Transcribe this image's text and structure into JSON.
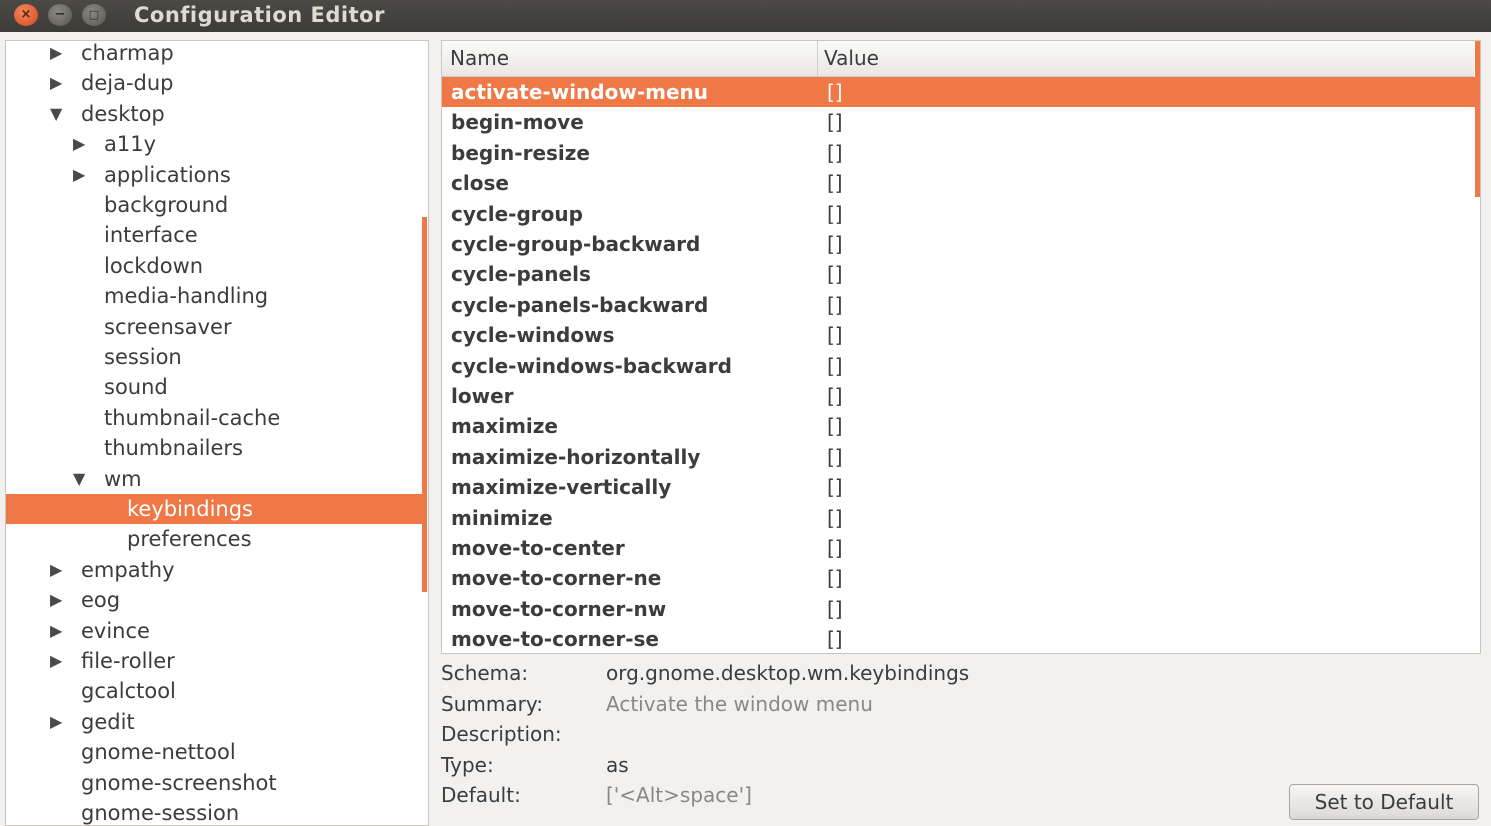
{
  "window": {
    "title": "Configuration Editor",
    "close_glyph": "×",
    "minimize_glyph": "−",
    "maximize_glyph": "□"
  },
  "tree": {
    "rows": [
      {
        "label": "charmap",
        "expander": "▶",
        "depth": 0,
        "selected": false
      },
      {
        "label": "deja-dup",
        "expander": "▶",
        "depth": 0,
        "selected": false
      },
      {
        "label": "desktop",
        "expander": "▼",
        "depth": 0,
        "selected": false
      },
      {
        "label": "a11y",
        "expander": "▶",
        "depth": 1,
        "selected": false
      },
      {
        "label": "applications",
        "expander": "▶",
        "depth": 1,
        "selected": false
      },
      {
        "label": "background",
        "expander": "",
        "depth": 1,
        "selected": false
      },
      {
        "label": "interface",
        "expander": "",
        "depth": 1,
        "selected": false
      },
      {
        "label": "lockdown",
        "expander": "",
        "depth": 1,
        "selected": false
      },
      {
        "label": "media-handling",
        "expander": "",
        "depth": 1,
        "selected": false
      },
      {
        "label": "screensaver",
        "expander": "",
        "depth": 1,
        "selected": false
      },
      {
        "label": "session",
        "expander": "",
        "depth": 1,
        "selected": false
      },
      {
        "label": "sound",
        "expander": "",
        "depth": 1,
        "selected": false
      },
      {
        "label": "thumbnail-cache",
        "expander": "",
        "depth": 1,
        "selected": false
      },
      {
        "label": "thumbnailers",
        "expander": "",
        "depth": 1,
        "selected": false
      },
      {
        "label": "wm",
        "expander": "▼",
        "depth": 1,
        "selected": false
      },
      {
        "label": "keybindings",
        "expander": "",
        "depth": 2,
        "selected": true
      },
      {
        "label": "preferences",
        "expander": "",
        "depth": 2,
        "selected": false
      },
      {
        "label": "empathy",
        "expander": "▶",
        "depth": 0,
        "selected": false
      },
      {
        "label": "eog",
        "expander": "▶",
        "depth": 0,
        "selected": false
      },
      {
        "label": "evince",
        "expander": "▶",
        "depth": 0,
        "selected": false
      },
      {
        "label": "file-roller",
        "expander": "▶",
        "depth": 0,
        "selected": false
      },
      {
        "label": "gcalctool",
        "expander": "",
        "depth": 0,
        "selected": false
      },
      {
        "label": "gedit",
        "expander": "▶",
        "depth": 0,
        "selected": false
      },
      {
        "label": "gnome-nettool",
        "expander": "",
        "depth": 0,
        "selected": false
      },
      {
        "label": "gnome-screenshot",
        "expander": "",
        "depth": 0,
        "selected": false
      },
      {
        "label": "gnome-session",
        "expander": "",
        "depth": 0,
        "selected": false
      }
    ]
  },
  "list": {
    "columns": {
      "name": "Name",
      "value": "Value"
    },
    "rows": [
      {
        "name": "activate-window-menu",
        "value": "[]",
        "selected": true
      },
      {
        "name": "begin-move",
        "value": "[]",
        "selected": false
      },
      {
        "name": "begin-resize",
        "value": "[]",
        "selected": false
      },
      {
        "name": "close",
        "value": "[]",
        "selected": false
      },
      {
        "name": "cycle-group",
        "value": "[]",
        "selected": false
      },
      {
        "name": "cycle-group-backward",
        "value": "[]",
        "selected": false
      },
      {
        "name": "cycle-panels",
        "value": "[]",
        "selected": false
      },
      {
        "name": "cycle-panels-backward",
        "value": "[]",
        "selected": false
      },
      {
        "name": "cycle-windows",
        "value": "[]",
        "selected": false
      },
      {
        "name": "cycle-windows-backward",
        "value": "[]",
        "selected": false
      },
      {
        "name": "lower",
        "value": "[]",
        "selected": false
      },
      {
        "name": "maximize",
        "value": "[]",
        "selected": false
      },
      {
        "name": "maximize-horizontally",
        "value": "[]",
        "selected": false
      },
      {
        "name": "maximize-vertically",
        "value": "[]",
        "selected": false
      },
      {
        "name": "minimize",
        "value": "[]",
        "selected": false
      },
      {
        "name": "move-to-center",
        "value": "[]",
        "selected": false
      },
      {
        "name": "move-to-corner-ne",
        "value": "[]",
        "selected": false
      },
      {
        "name": "move-to-corner-nw",
        "value": "[]",
        "selected": false
      },
      {
        "name": "move-to-corner-se",
        "value": "[]",
        "selected": false
      }
    ]
  },
  "details": {
    "schema_label": "Schema:",
    "schema_value": "org.gnome.desktop.wm.keybindings",
    "summary_label": "Summary:",
    "summary_value": "Activate the window menu",
    "description_label": "Description:",
    "description_value": "",
    "type_label": "Type:",
    "type_value": "as",
    "default_label": "Default:",
    "default_value": "['<Alt>space']"
  },
  "buttons": {
    "set_to_default": "Set to Default"
  },
  "colors": {
    "accent": "#f07746",
    "titlebar": "#3c3b37"
  }
}
